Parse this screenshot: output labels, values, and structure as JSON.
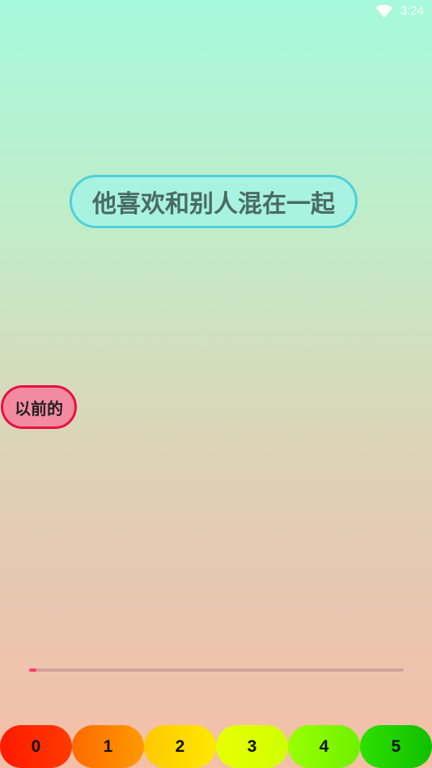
{
  "status_bar": {
    "time": "3:24",
    "wifi_icon": "wifi-icon"
  },
  "phrase": {
    "text": "他喜欢和别人混在一起"
  },
  "previous_button": {
    "label": "以前的"
  },
  "progress": {
    "fraction": 0.02,
    "color": "#ff3d6b"
  },
  "rating_buttons": [
    {
      "label": "0",
      "color_from": "#ff1a00",
      "color_to": "#ff3a00"
    },
    {
      "label": "1",
      "color_from": "#ff6a00",
      "color_to": "#ff9a00"
    },
    {
      "label": "2",
      "color_from": "#ffc800",
      "color_to": "#ffe800"
    },
    {
      "label": "3",
      "color_from": "#e8ff00",
      "color_to": "#d0ff00"
    },
    {
      "label": "4",
      "color_from": "#9aff00",
      "color_to": "#6ef000"
    },
    {
      "label": "5",
      "color_from": "#2ee000",
      "color_to": "#10c000"
    }
  ]
}
